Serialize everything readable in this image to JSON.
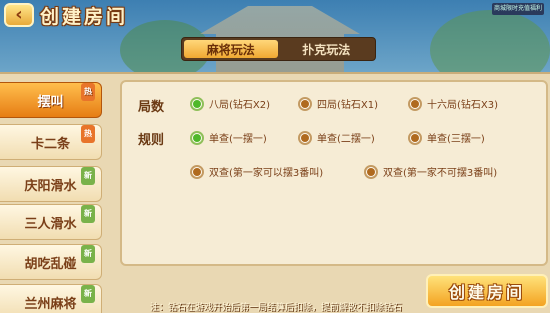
{
  "header": {
    "title": "创建房间",
    "back_icon": "back-arrow-icon",
    "corner_tag": "商城限时充值福利"
  },
  "tabs": [
    {
      "label": "麻将玩法",
      "active": true
    },
    {
      "label": "扑克玩法",
      "active": false
    }
  ],
  "sidebar": {
    "items": [
      {
        "label": "摆叫",
        "active": true,
        "badge": "热"
      },
      {
        "label": "卡二条",
        "active": false,
        "badge": "热"
      },
      {
        "label": "庆阳滑水",
        "active": false,
        "badge": "新"
      },
      {
        "label": "三人滑水",
        "active": false,
        "badge": "新"
      },
      {
        "label": "胡吃乱碰",
        "active": false,
        "badge": "新"
      },
      {
        "label": "兰州麻将",
        "active": false,
        "badge": "新"
      }
    ]
  },
  "options": {
    "rounds": {
      "label": "局数",
      "choices": [
        {
          "text": "八局(钻石X2)",
          "selected": true
        },
        {
          "text": "四局(钻石X1)",
          "selected": false
        },
        {
          "text": "十六局(钻石X3)",
          "selected": false
        }
      ]
    },
    "rules": {
      "label": "规则",
      "choices": [
        {
          "text": "单查(一摆一)",
          "selected": true
        },
        {
          "text": "单查(二摆一)",
          "selected": false
        },
        {
          "text": "单查(三摆一)",
          "selected": false
        },
        {
          "text": "双查(第一家可以摆3番叫)",
          "selected": false
        },
        {
          "text": "双查(第一家不可摆3番叫)",
          "selected": false
        }
      ]
    }
  },
  "footer": {
    "note": "注：钻石在游戏开始后第一局结算后扣除，提前解散不扣除钻石",
    "create_button": "创建房间"
  },
  "colors": {
    "accent": "#f3a322",
    "selected_radio": "#4fb82a",
    "unselected_radio": "#b06a1e"
  }
}
